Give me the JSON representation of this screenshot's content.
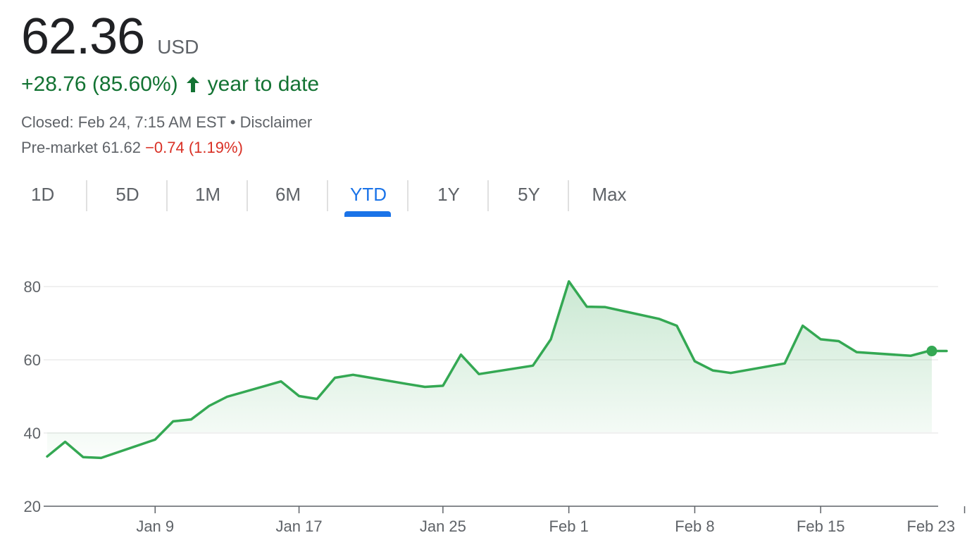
{
  "quote": {
    "price": "62.36",
    "currency": "USD",
    "change_text": "+28.76 (85.60%)",
    "period_text": "year to date",
    "closed_text": "Closed: Feb 24, 7:15 AM EST • Disclaimer",
    "premarket_label": "Pre-market 61.62 ",
    "premarket_change": "−0.74 (1.19%)",
    "up_color": "#137333",
    "down_color": "#d93025"
  },
  "tabs": [
    {
      "label": "1D",
      "active": false
    },
    {
      "label": "5D",
      "active": false
    },
    {
      "label": "1M",
      "active": false
    },
    {
      "label": "6M",
      "active": false
    },
    {
      "label": "YTD",
      "active": true
    },
    {
      "label": "1Y",
      "active": false
    },
    {
      "label": "5Y",
      "active": false
    },
    {
      "label": "Max",
      "active": false
    }
  ],
  "chart_data": {
    "type": "area",
    "line_color": "#34a853",
    "grid": true,
    "ylim": [
      20,
      90
    ],
    "y_ticks": [
      20,
      40,
      60,
      80
    ],
    "x_ticks": [
      {
        "label": "Jan 9",
        "day": 9
      },
      {
        "label": "Jan 17",
        "day": 17
      },
      {
        "label": "Jan 25",
        "day": 25
      },
      {
        "label": "Feb 1",
        "day": 32
      },
      {
        "label": "Feb 8",
        "day": 39
      },
      {
        "label": "Feb 15",
        "day": 46
      },
      {
        "label": "Feb 23",
        "day": 54
      }
    ],
    "series": [
      {
        "x": [
          3,
          4,
          5,
          6,
          9,
          10,
          11,
          12,
          13,
          16,
          17,
          18,
          19,
          20,
          23,
          24,
          25,
          26,
          27,
          30,
          31,
          32,
          33,
          34,
          37,
          38,
          39,
          40,
          41,
          44,
          45,
          46,
          47,
          48,
          51,
          52,
          53,
          54
        ],
        "y": [
          33.6,
          37.6,
          33.4,
          33.2,
          38.2,
          43.2,
          43.7,
          47.4,
          49.9,
          54.1,
          50.1,
          49.3,
          55.1,
          55.9,
          53.4,
          52.6,
          52.9,
          61.4,
          56.1,
          58.4,
          65.6,
          81.4,
          74.5,
          74.4,
          71.2,
          69.3,
          59.6,
          57.1,
          56.4,
          59.0,
          69.3,
          65.6,
          65.1,
          62.1,
          61.1,
          62.4,
          62.4,
          62.4
        ]
      }
    ]
  }
}
